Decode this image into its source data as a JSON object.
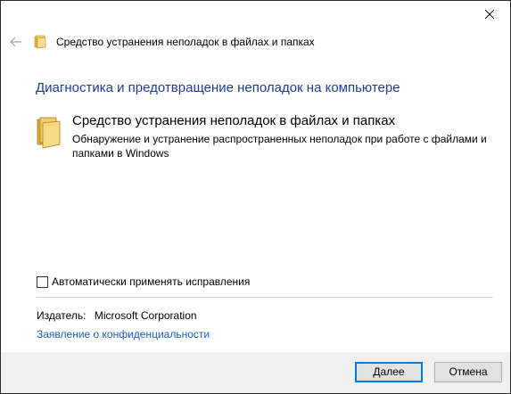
{
  "header": {
    "title": "Средство устранения неполадок в файлах и папках"
  },
  "main": {
    "heading": "Диагностика и предотвращение неполадок на компьютере",
    "item_title": "Средство устранения неполадок в файлах и папках",
    "item_description": "Обнаружение и устранение распространенных неполадок при работе с файлами и папками в Windows"
  },
  "options": {
    "auto_apply_label": "Автоматически применять исправления",
    "auto_apply_checked": false
  },
  "publisher": {
    "label": "Издатель:",
    "value": "Microsoft Corporation"
  },
  "links": {
    "privacy": "Заявление о конфиденциальности"
  },
  "buttons": {
    "next": "Далее",
    "cancel": "Отмена"
  },
  "colors": {
    "heading": "#1e3d8f",
    "link": "#1a5fb4",
    "default_button_border": "#0078d7",
    "footer_bg": "#f0f0f0"
  },
  "icons": {
    "close": "close-icon",
    "back": "back-arrow-icon",
    "folder": "folder-icon"
  }
}
